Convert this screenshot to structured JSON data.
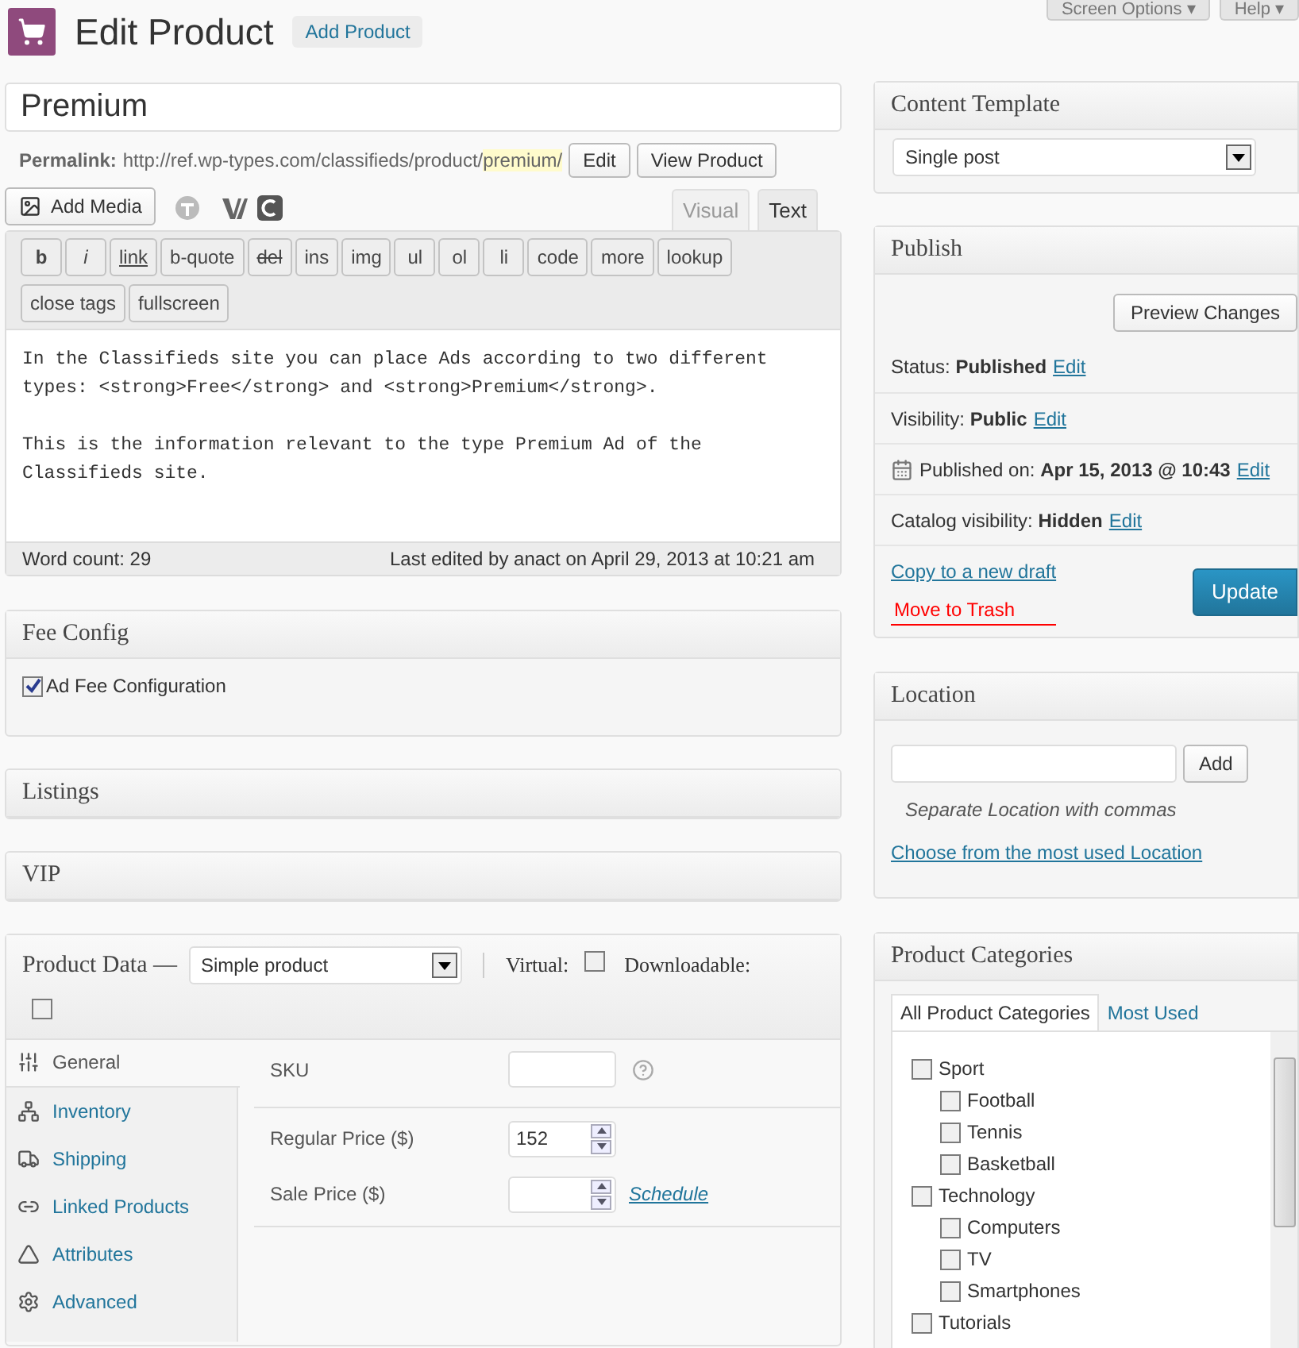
{
  "screen_tabs": [
    {
      "label": "Screen Options ▾"
    },
    {
      "label": "Help ▾"
    }
  ],
  "header": {
    "title": "Edit Product",
    "add_button": "Add Product"
  },
  "post_title": {
    "value": "Premium"
  },
  "permalink": {
    "label": "Permalink:",
    "url_base": "http://ref.wp-types.com/classifieds/product/",
    "slug": "premium/",
    "buttons": [
      "Edit",
      "View Product"
    ]
  },
  "editor": {
    "add_media": "Add Media",
    "tabs": [
      {
        "label": "Visual",
        "selected": false
      },
      {
        "label": "Text",
        "selected": true
      }
    ],
    "quicktags": [
      {
        "label": "b",
        "kind": "bold"
      },
      {
        "label": "i",
        "kind": "italic"
      },
      {
        "label": "link",
        "kind": "underline"
      },
      {
        "label": "b-quote",
        "kind": "plain"
      },
      {
        "label": "del",
        "kind": "strike"
      },
      {
        "label": "ins",
        "kind": "plain"
      },
      {
        "label": "img",
        "kind": "plain"
      },
      {
        "label": "ul",
        "kind": "plain"
      },
      {
        "label": "ol",
        "kind": "plain"
      },
      {
        "label": "li",
        "kind": "plain"
      },
      {
        "label": "code",
        "kind": "plain"
      },
      {
        "label": "more",
        "kind": "plain"
      },
      {
        "label": "lookup",
        "kind": "plain"
      },
      {
        "label": "close tags",
        "kind": "plain"
      },
      {
        "label": "fullscreen",
        "kind": "plain"
      }
    ],
    "paragraphs": [
      "In the Classifieds site you can place Ads according to two different types: <strong>Free</strong> and <strong>Premium</strong>.",
      "This is the information relevant to the type Premium Ad of the Classifieds site."
    ],
    "word_count": "Word count: 29",
    "last_edited": "Last edited by anact on April 29, 2013 at 10:21 am"
  },
  "fee_config": {
    "title": "Fee Config",
    "checkbox": {
      "label": "Ad Fee Configuration",
      "checked": true
    }
  },
  "listings": {
    "title": "Listings"
  },
  "vip": {
    "title": "VIP"
  },
  "product_data": {
    "title": "Product Data —",
    "type_select": "Simple product",
    "virtual": {
      "label": "Virtual:",
      "checked": false
    },
    "downloadable": {
      "label": "Downloadable:",
      "checked": false
    },
    "tabs": [
      {
        "label": "General",
        "kind": "general",
        "selected": true
      },
      {
        "label": "Inventory",
        "kind": "inventory",
        "selected": false
      },
      {
        "label": "Shipping",
        "kind": "shipping",
        "selected": false
      },
      {
        "label": "Linked Products",
        "kind": "linked",
        "selected": false
      },
      {
        "label": "Attributes",
        "kind": "attributes",
        "selected": false
      },
      {
        "label": "Advanced",
        "kind": "advanced",
        "selected": false
      }
    ],
    "field_groups": [
      [
        {
          "label": "SKU",
          "kind": "text_help"
        }
      ],
      [
        {
          "label": "Regular Price ($)",
          "kind": "number",
          "value": "152"
        },
        {
          "label": "Sale Price ($)",
          "kind": "number",
          "link": "Schedule"
        }
      ]
    ]
  },
  "content_template": {
    "title": "Content Template",
    "select": "Single post"
  },
  "publish": {
    "title": "Publish",
    "preview_button": "Preview Changes",
    "rows": [
      {
        "kind": "plain",
        "label": "Status:",
        "value": "Published",
        "edit": "Edit"
      },
      {
        "kind": "plain",
        "label": "Visibility:",
        "value": "Public",
        "edit": "Edit"
      },
      {
        "kind": "date",
        "label": "Published on:",
        "value": "Apr 15, 2013 @ 10:43",
        "edit": "Edit"
      },
      {
        "kind": "plain",
        "label": "Catalog visibility:",
        "value": "Hidden",
        "edit": "Edit"
      }
    ],
    "copy_link": "Copy to a new draft",
    "trash_link": "Move to Trash",
    "update_button": "Update"
  },
  "location": {
    "title": "Location",
    "add_button": "Add",
    "hint": "Separate Location with commas",
    "choose_link": "Choose from the most used Location"
  },
  "product_categories": {
    "title": "Product Categories",
    "tabs": [
      {
        "label": "All Product Categories",
        "selected": true
      },
      {
        "label": "Most Used",
        "selected": false
      }
    ],
    "items": [
      {
        "label": "Sport",
        "checked": false,
        "children": [
          {
            "label": "Football",
            "checked": false
          },
          {
            "label": "Tennis",
            "checked": false
          },
          {
            "label": "Basketball",
            "checked": false
          }
        ]
      },
      {
        "label": "Technology",
        "checked": false,
        "children": [
          {
            "label": "Computers",
            "checked": false
          },
          {
            "label": "TV",
            "checked": false
          },
          {
            "label": "Smartphones",
            "checked": false
          }
        ]
      },
      {
        "label": "Tutorials",
        "checked": false
      }
    ]
  }
}
